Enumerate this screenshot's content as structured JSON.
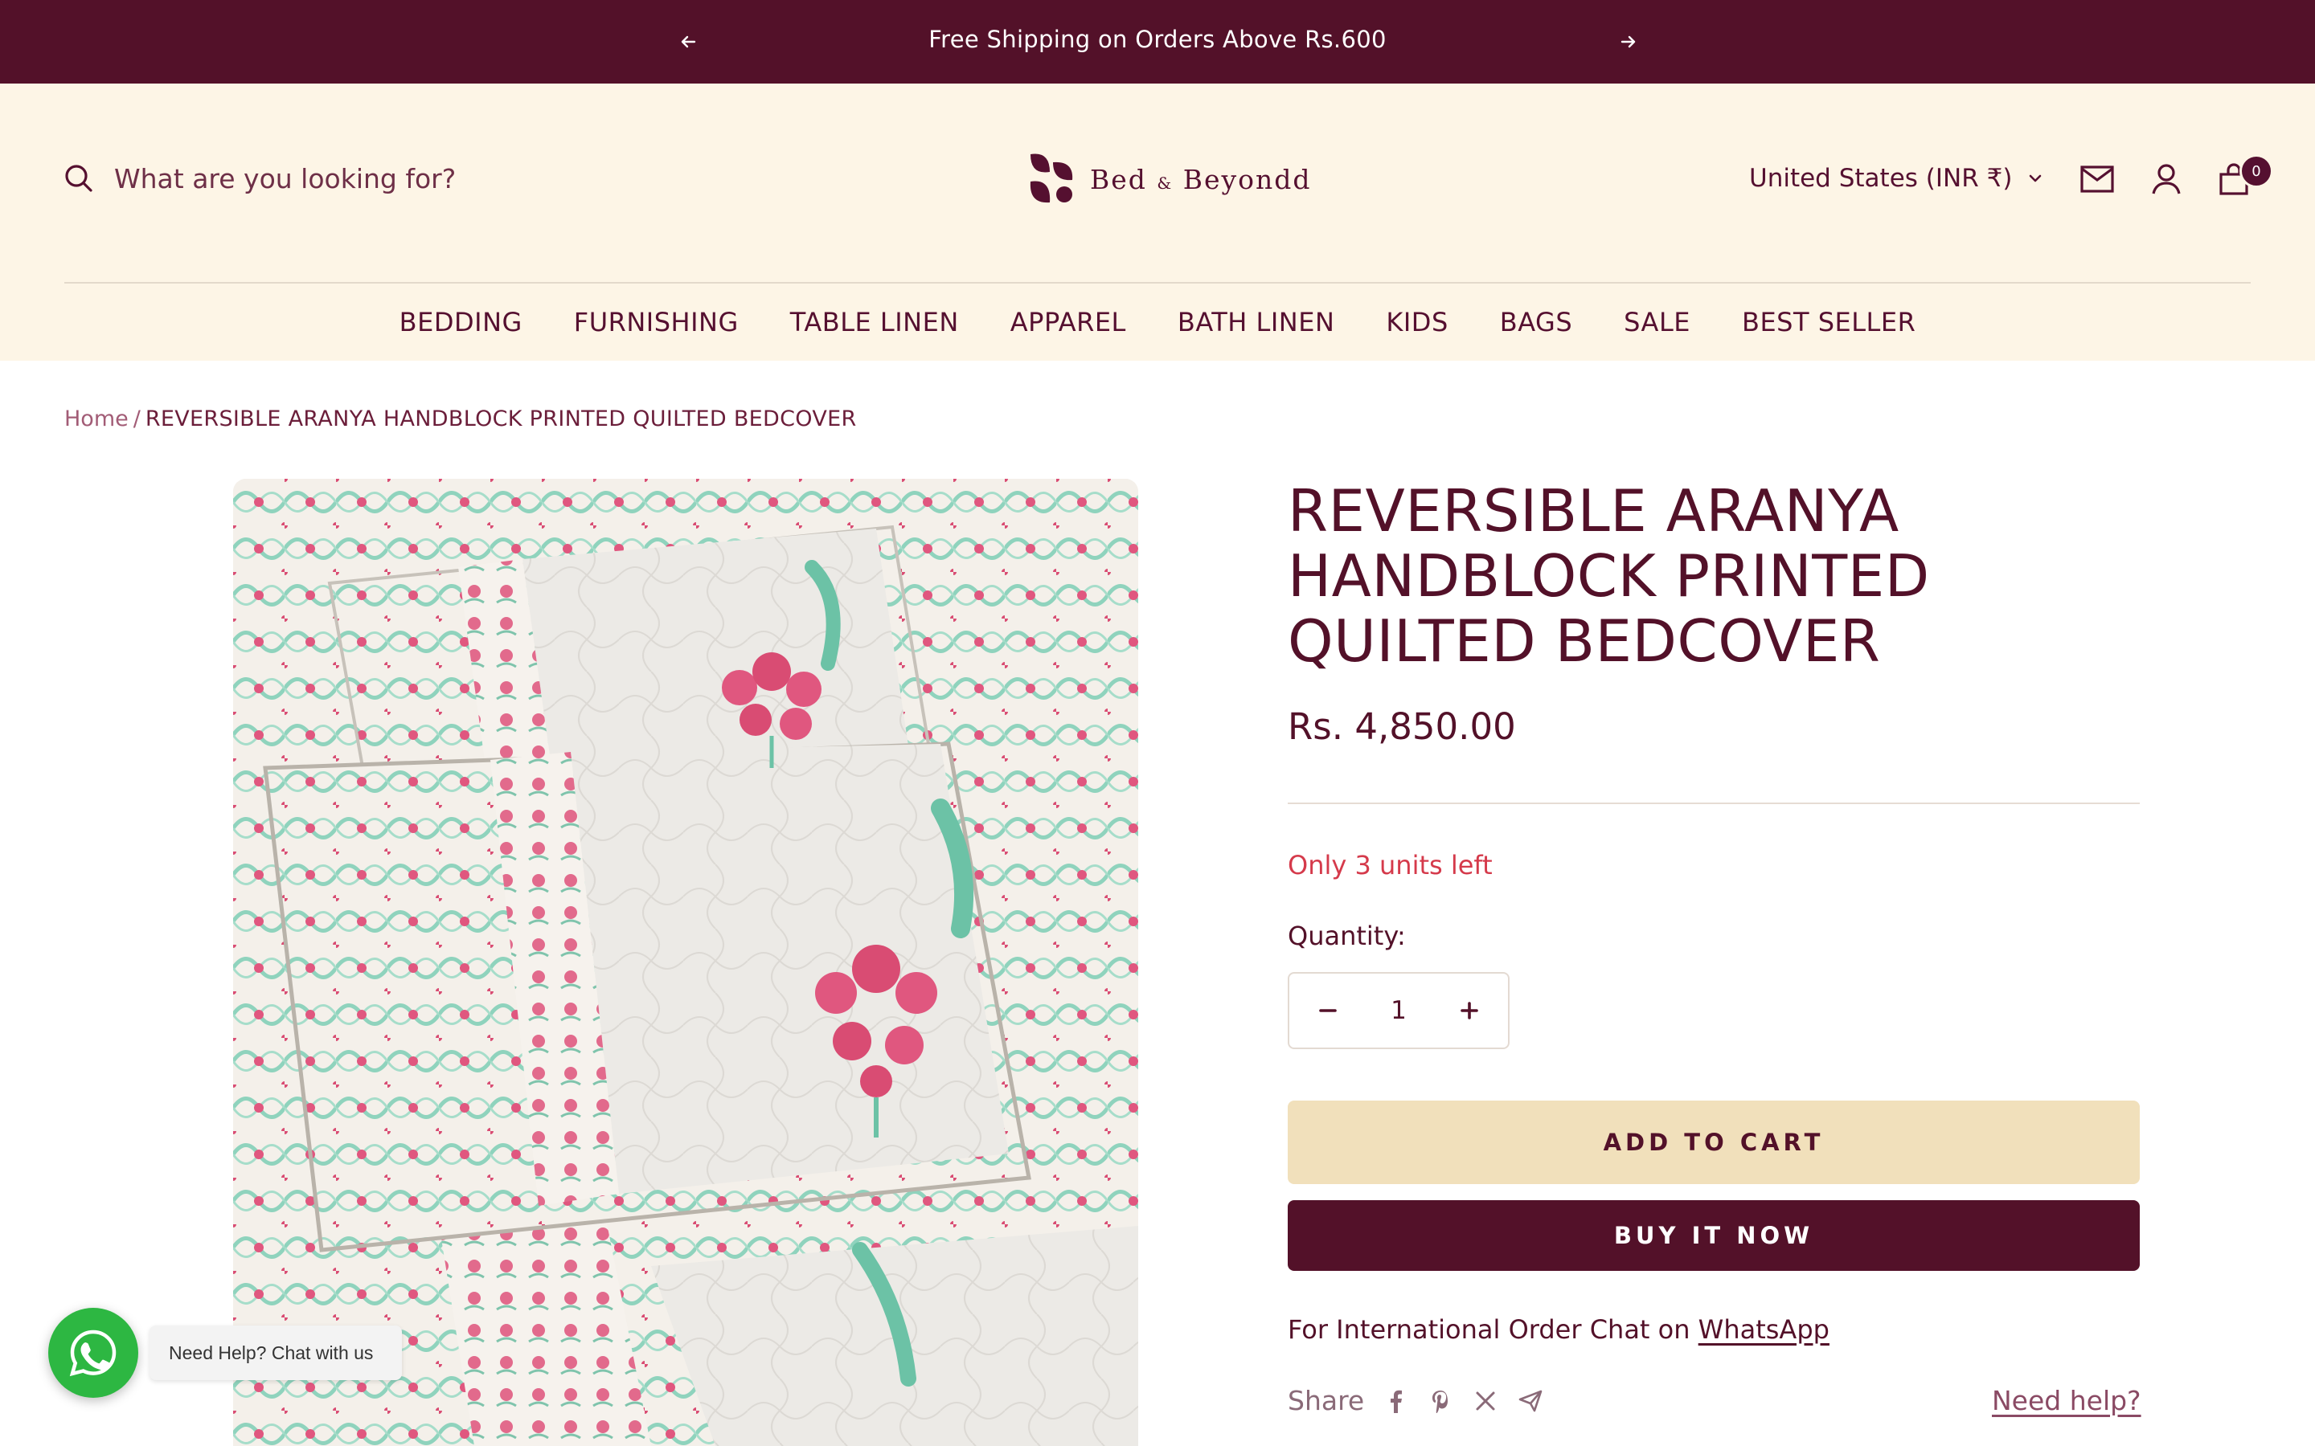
{
  "announcement": {
    "text": "Free Shipping on Orders Above Rs.600"
  },
  "search": {
    "placeholder": "What are you looking for?"
  },
  "brand": {
    "name": "Bed",
    "amp": "&",
    "name2": "Beyondd"
  },
  "header": {
    "country": "United States (INR ₹)",
    "cart_count": "0"
  },
  "nav": [
    "BEDDING",
    "FURNISHING",
    "TABLE LINEN",
    "APPAREL",
    "BATH LINEN",
    "KIDS",
    "BAGS",
    "SALE",
    "BEST SELLER"
  ],
  "breadcrumb": {
    "home": "Home",
    "sep": "/",
    "current": "REVERSIBLE ARANYA HANDBLOCK PRINTED QUILTED BEDCOVER"
  },
  "product": {
    "title": "REVERSIBLE ARANYA HANDBLOCK PRINTED QUILTED BEDCOVER",
    "price": "Rs. 4,850.00",
    "stock": "Only 3 units left",
    "quantity_label": "Quantity:",
    "quantity": "1",
    "add_to_cart": "ADD TO CART",
    "buy_now": "BUY IT NOW",
    "intl_text": "For International Order Chat on",
    "intl_link": "WhatsApp",
    "share_label": "Share",
    "need_help": "Need help?"
  },
  "whatsapp": {
    "tooltip": "Need Help? Chat with us"
  },
  "colors": {
    "brand": "#531129",
    "header_bg": "#fdf5e6",
    "add_to_cart_bg": "#f1e0bb",
    "stock": "#d53a4b",
    "whatsapp": "#2db742"
  }
}
